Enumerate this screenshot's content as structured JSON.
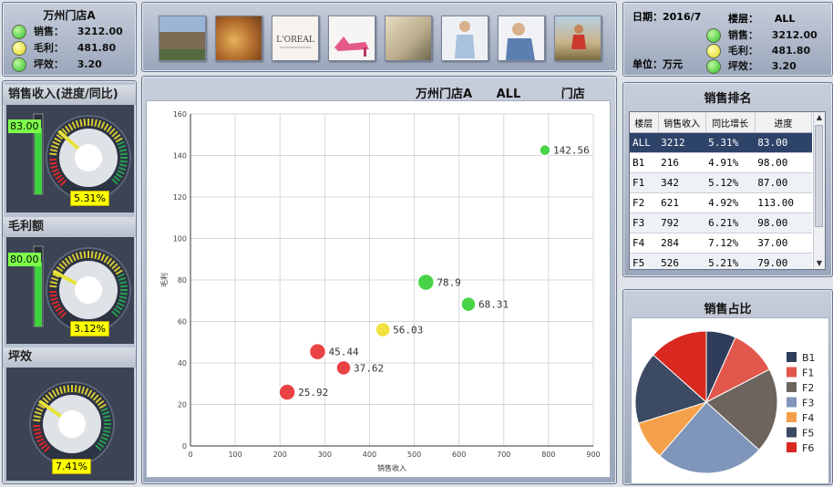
{
  "store_panel": {
    "title": "万州门店A",
    "rows": [
      {
        "label": "销售：",
        "value": "3212.00",
        "status": "green"
      },
      {
        "label": "毛利：",
        "value": "481.80",
        "status": "yellow"
      },
      {
        "label": "坪效：",
        "value": "3.20",
        "status": "green"
      }
    ]
  },
  "date_panel": {
    "date": "日期：2016/7",
    "floor_label": "楼层：",
    "floor": "ALL",
    "unit": "单位：万元",
    "rows": [
      {
        "label": "销售：",
        "value": "3212.00",
        "status": "green"
      },
      {
        "label": "毛利：",
        "value": "481.80",
        "status": "yellow"
      },
      {
        "label": "坪效：",
        "value": "3.20",
        "status": "green"
      }
    ]
  },
  "photos": [
    "mall-photo",
    "food-photo",
    "loreal-photo",
    "shoe-photo",
    "interior-photo",
    "fashion-woman-photo",
    "fashion-man-photo",
    "sports-photo"
  ],
  "gauges": [
    {
      "title": "销售收入(进度/同比)",
      "level": "83.00",
      "level_fraction": 0.83,
      "pct": "5.31%",
      "needle_deg": -48
    },
    {
      "title": "毛利额",
      "level": "80.00",
      "level_fraction": 0.8,
      "pct": "3.12%",
      "needle_deg": -62
    },
    {
      "title": "坪效",
      "pct": "7.41%",
      "needle_deg": -55
    }
  ],
  "chart_header": {
    "store": "万州门店A",
    "floor": "ALL",
    "type": "门店"
  },
  "chart_data": {
    "type": "scatter",
    "xlabel": "销售收入",
    "ylabel": "毛利",
    "xlim": [
      0,
      900
    ],
    "ylim": [
      0,
      160
    ],
    "xticks": [
      0,
      100,
      200,
      300,
      400,
      500,
      600,
      700,
      800,
      900
    ],
    "yticks": [
      0,
      20,
      40,
      60,
      80,
      100,
      120,
      140,
      160
    ],
    "grid": true,
    "points": [
      {
        "x": 216,
        "y": 25.92,
        "label": "25.92",
        "color": "#e8383a",
        "size": 2
      },
      {
        "x": 284,
        "y": 45.44,
        "label": "45.44",
        "color": "#e8383a",
        "size": 2
      },
      {
        "x": 342,
        "y": 37.62,
        "label": "37.62",
        "color": "#e8383a",
        "size": 1
      },
      {
        "x": 430,
        "y": 56.03,
        "label": "56.03",
        "color": "#f2e034",
        "size": 1
      },
      {
        "x": 526,
        "y": 78.9,
        "label": "78.9",
        "color": "#3fd23f",
        "size": 2
      },
      {
        "x": 621,
        "y": 68.31,
        "label": "68.31",
        "color": "#3fd23f",
        "size": 1
      },
      {
        "x": 792,
        "y": 142.56,
        "label": "142.56",
        "color": "#3fd23f",
        "size": 0
      }
    ]
  },
  "ranking": {
    "title": "销售排名",
    "columns": [
      "楼层",
      "销售收入",
      "同比增长",
      "进度"
    ],
    "rows": [
      [
        "ALL",
        "3212",
        "5.31%",
        "83.00"
      ],
      [
        "B1",
        "216",
        "4.91%",
        "98.00"
      ],
      [
        "F1",
        "342",
        "5.12%",
        "87.00"
      ],
      [
        "F2",
        "621",
        "4.92%",
        "113.00"
      ],
      [
        "F3",
        "792",
        "6.21%",
        "98.00"
      ],
      [
        "F4",
        "284",
        "7.12%",
        "37.00"
      ],
      [
        "F5",
        "526",
        "5.21%",
        "79.00"
      ]
    ]
  },
  "share": {
    "title": "销售占比",
    "slices": [
      {
        "name": "B1",
        "value": 216,
        "color": "#2f3d5a"
      },
      {
        "name": "F1",
        "value": 342,
        "color": "#e2574c"
      },
      {
        "name": "F2",
        "value": 621,
        "color": "#6d645d"
      },
      {
        "name": "F3",
        "value": 792,
        "color": "#7f95b9"
      },
      {
        "name": "F4",
        "value": 284,
        "color": "#f5a04a"
      },
      {
        "name": "F5",
        "value": 526,
        "color": "#3c4a63"
      },
      {
        "name": "F6",
        "value": 431,
        "color": "#d8281f"
      }
    ]
  }
}
